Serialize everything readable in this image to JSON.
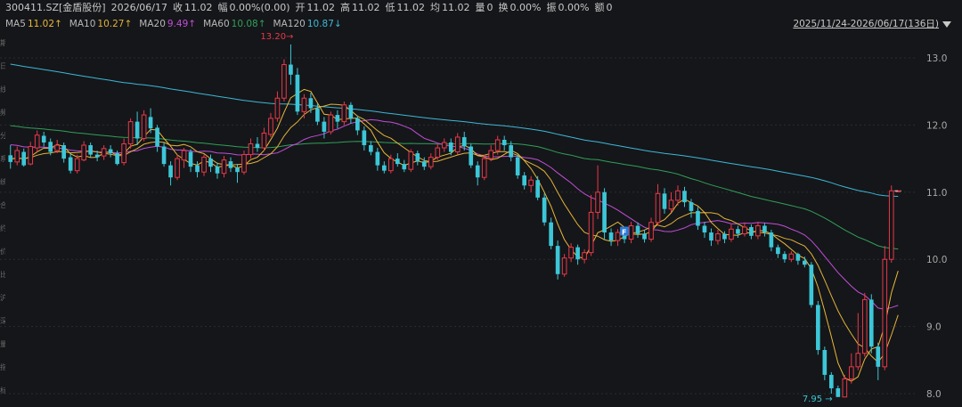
{
  "header": {
    "symbol": "300411.SZ[金盾股份]",
    "date": "2026/06/17",
    "items": [
      {
        "label": "收",
        "value": "11.02"
      },
      {
        "label": "幅",
        "value": "0.00%(0.00)"
      },
      {
        "label": "开",
        "value": "11.02"
      },
      {
        "label": "高",
        "value": "11.02"
      },
      {
        "label": "低",
        "value": "11.02"
      },
      {
        "label": "均",
        "value": "11.02"
      },
      {
        "label": "量",
        "value": "0"
      },
      {
        "label": "换",
        "value": "0.00%"
      },
      {
        "label": "振",
        "value": "0.00%"
      },
      {
        "label": "额",
        "value": "0"
      }
    ]
  },
  "ma_legend": [
    {
      "name": "MA5",
      "value": "11.02↑",
      "color": "#e8b93a"
    },
    {
      "name": "MA10",
      "value": "10.27↑",
      "color": "#e0b23a"
    },
    {
      "name": "MA20",
      "value": "9.49↑",
      "color": "#c14ed8"
    },
    {
      "name": "MA60",
      "value": "10.08↑",
      "color": "#2fa05a"
    },
    {
      "name": "MA120",
      "value": "10.87↓",
      "color": "#3cb8d8"
    }
  ],
  "range_label": "2025/11/24-2026/06/17(136日)",
  "side_glyphs": "期 日 线 频 分 系 统 合 约 价 比 沪 深 量 指 标",
  "chart_data": {
    "type": "candlestick",
    "ylim": [
      7.9,
      13.3
    ],
    "yticks": [
      "13.0",
      "12.0",
      "11.0",
      "10.0",
      "9.0",
      "8.0"
    ],
    "colors": {
      "up": "#e8394a",
      "down": "#3cc7d8",
      "ma5": "#e8b93a",
      "ma10": "#e0b23a",
      "ma20": "#c14ed8",
      "ma60": "#2fa05a",
      "ma120": "#3cb8d8"
    },
    "annotations": {
      "high": "13.20",
      "low": "7.95",
      "marker": "F"
    },
    "candles": [
      [
        11.55,
        11.45,
        11.7,
        11.35
      ],
      [
        11.45,
        11.62,
        11.68,
        11.4
      ],
      [
        11.6,
        11.4,
        11.65,
        11.38
      ],
      [
        11.42,
        11.68,
        11.75,
        11.4
      ],
      [
        11.66,
        11.85,
        11.92,
        11.6
      ],
      [
        11.84,
        11.74,
        11.9,
        11.68
      ],
      [
        11.75,
        11.6,
        11.8,
        11.55
      ],
      [
        11.62,
        11.7,
        11.78,
        11.58
      ],
      [
        11.7,
        11.5,
        11.74,
        11.44
      ],
      [
        11.52,
        11.32,
        11.58,
        11.28
      ],
      [
        11.32,
        11.5,
        11.56,
        11.28
      ],
      [
        11.48,
        11.7,
        11.76,
        11.46
      ],
      [
        11.7,
        11.56,
        11.74,
        11.52
      ],
      [
        11.56,
        11.52,
        11.62,
        11.46
      ],
      [
        11.54,
        11.65,
        11.7,
        11.48
      ],
      [
        11.64,
        11.58,
        11.7,
        11.52
      ],
      [
        11.58,
        11.42,
        11.62,
        11.4
      ],
      [
        11.44,
        11.72,
        11.8,
        11.4
      ],
      [
        11.72,
        12.05,
        12.1,
        11.65
      ],
      [
        12.05,
        11.8,
        12.2,
        11.7
      ],
      [
        11.8,
        12.15,
        12.22,
        11.76
      ],
      [
        12.12,
        11.95,
        12.25,
        11.88
      ],
      [
        11.96,
        11.68,
        12.0,
        11.6
      ],
      [
        11.68,
        11.42,
        11.74,
        11.38
      ],
      [
        11.4,
        11.22,
        11.46,
        11.1
      ],
      [
        11.22,
        11.5,
        11.56,
        11.18
      ],
      [
        11.48,
        11.62,
        11.66,
        11.36
      ],
      [
        11.6,
        11.38,
        11.64,
        11.3
      ],
      [
        11.4,
        11.3,
        11.46,
        11.22
      ],
      [
        11.3,
        11.52,
        11.56,
        11.24
      ],
      [
        11.5,
        11.38,
        11.56,
        11.3
      ],
      [
        11.38,
        11.28,
        11.44,
        11.2
      ],
      [
        11.28,
        11.48,
        11.54,
        11.22
      ],
      [
        11.46,
        11.36,
        11.52,
        11.3
      ],
      [
        11.36,
        11.3,
        11.42,
        11.14
      ],
      [
        11.3,
        11.56,
        11.62,
        11.26
      ],
      [
        11.56,
        11.72,
        11.8,
        11.5
      ],
      [
        11.72,
        11.66,
        11.82,
        11.6
      ],
      [
        11.66,
        11.88,
        11.96,
        11.62
      ],
      [
        11.86,
        12.1,
        12.18,
        11.82
      ],
      [
        12.1,
        12.4,
        12.5,
        12.05
      ],
      [
        12.4,
        12.9,
        12.98,
        12.35
      ],
      [
        12.9,
        12.75,
        13.2,
        12.6
      ],
      [
        12.75,
        12.2,
        12.85,
        12.15
      ],
      [
        12.2,
        12.4,
        12.46,
        12.1
      ],
      [
        12.4,
        12.25,
        12.48,
        12.18
      ],
      [
        12.25,
        12.05,
        12.32,
        12.0
      ],
      [
        12.05,
        11.9,
        12.12,
        11.8
      ],
      [
        11.9,
        12.15,
        12.2,
        11.86
      ],
      [
        12.15,
        12.05,
        12.22,
        11.95
      ],
      [
        12.05,
        12.3,
        12.35,
        12.0
      ],
      [
        12.3,
        12.1,
        12.34,
        12.02
      ],
      [
        12.1,
        11.92,
        12.14,
        11.85
      ],
      [
        11.92,
        11.7,
        11.98,
        11.62
      ],
      [
        11.7,
        11.6,
        11.76,
        11.55
      ],
      [
        11.6,
        11.4,
        11.66,
        11.32
      ],
      [
        11.4,
        11.32,
        11.46,
        11.28
      ],
      [
        11.32,
        11.5,
        11.56,
        11.28
      ],
      [
        11.5,
        11.42,
        11.58,
        11.38
      ],
      [
        11.42,
        11.34,
        11.48,
        11.3
      ],
      [
        11.34,
        11.6,
        11.64,
        11.3
      ],
      [
        11.58,
        11.46,
        11.62,
        11.4
      ],
      [
        11.46,
        11.38,
        11.52,
        11.33
      ],
      [
        11.38,
        11.52,
        11.58,
        11.34
      ],
      [
        11.52,
        11.66,
        11.72,
        11.48
      ],
      [
        11.66,
        11.74,
        11.8,
        11.6
      ],
      [
        11.74,
        11.6,
        11.8,
        11.55
      ],
      [
        11.6,
        11.82,
        11.88,
        11.56
      ],
      [
        11.82,
        11.68,
        11.9,
        11.62
      ],
      [
        11.68,
        11.4,
        11.72,
        11.36
      ],
      [
        11.4,
        11.22,
        11.46,
        11.1
      ],
      [
        11.22,
        11.5,
        11.56,
        11.18
      ],
      [
        11.5,
        11.62,
        11.7,
        11.46
      ],
      [
        11.62,
        11.78,
        11.84,
        11.56
      ],
      [
        11.78,
        11.7,
        11.84,
        11.62
      ],
      [
        11.7,
        11.52,
        11.76,
        11.46
      ],
      [
        11.52,
        11.25,
        11.56,
        11.2
      ],
      [
        11.25,
        11.1,
        11.3,
        11.04
      ],
      [
        11.1,
        11.18,
        11.24,
        11.0
      ],
      [
        11.18,
        10.92,
        11.24,
        10.88
      ],
      [
        10.92,
        10.55,
        10.98,
        10.5
      ],
      [
        10.55,
        10.2,
        10.62,
        10.15
      ],
      [
        10.2,
        9.78,
        10.28,
        9.7
      ],
      [
        9.78,
        10.02,
        10.08,
        9.74
      ],
      [
        10.02,
        10.18,
        10.24,
        9.96
      ],
      [
        10.18,
        10.0,
        10.22,
        9.92
      ],
      [
        10.0,
        10.1,
        10.15,
        9.94
      ],
      [
        10.1,
        10.7,
        10.96,
        10.05
      ],
      [
        10.7,
        11.0,
        11.4,
        10.6
      ],
      [
        11.0,
        10.4,
        11.06,
        10.3
      ],
      [
        10.4,
        10.28,
        10.46,
        10.2
      ],
      [
        10.28,
        10.4,
        10.45,
        10.2
      ],
      [
        10.4,
        10.3,
        10.46,
        10.24
      ],
      [
        10.3,
        10.5,
        10.56,
        10.24
      ],
      [
        10.5,
        10.38,
        10.55,
        10.32
      ],
      [
        10.38,
        10.3,
        10.44,
        10.25
      ],
      [
        10.3,
        10.55,
        10.62,
        10.26
      ],
      [
        10.55,
        10.98,
        11.12,
        10.5
      ],
      [
        10.98,
        10.75,
        11.06,
        10.68
      ],
      [
        10.75,
        10.88,
        11.0,
        10.7
      ],
      [
        10.88,
        11.02,
        11.1,
        10.8
      ],
      [
        11.02,
        10.85,
        11.08,
        10.78
      ],
      [
        10.85,
        10.72,
        10.9,
        10.62
      ],
      [
        10.72,
        10.5,
        10.78,
        10.44
      ],
      [
        10.5,
        10.4,
        10.56,
        10.32
      ],
      [
        10.4,
        10.28,
        10.46,
        10.2
      ],
      [
        10.28,
        10.38,
        10.44,
        10.22
      ],
      [
        10.38,
        10.3,
        10.42,
        10.24
      ],
      [
        10.3,
        10.45,
        10.52,
        10.26
      ],
      [
        10.45,
        10.38,
        10.5,
        10.32
      ],
      [
        10.38,
        10.48,
        10.55,
        10.34
      ],
      [
        10.48,
        10.35,
        10.52,
        10.3
      ],
      [
        10.35,
        10.5,
        10.56,
        10.3
      ],
      [
        10.5,
        10.4,
        10.54,
        10.34
      ],
      [
        10.4,
        10.18,
        10.44,
        10.12
      ],
      [
        10.18,
        10.08,
        10.22,
        10.02
      ],
      [
        10.08,
        10.0,
        10.12,
        9.95
      ],
      [
        10.0,
        10.08,
        10.12,
        9.96
      ],
      [
        10.08,
        9.98,
        10.1,
        9.92
      ],
      [
        9.98,
        9.92,
        10.04,
        9.88
      ],
      [
        9.92,
        9.32,
        9.96,
        9.28
      ],
      [
        9.32,
        8.65,
        9.38,
        8.58
      ],
      [
        8.65,
        8.28,
        8.7,
        8.2
      ],
      [
        8.28,
        8.08,
        8.32,
        8.0
      ],
      [
        8.08,
        7.95,
        8.12,
        7.95
      ],
      [
        7.95,
        8.22,
        8.28,
        7.95
      ],
      [
        8.22,
        8.4,
        8.6,
        8.15
      ],
      [
        8.4,
        8.6,
        9.2,
        8.35
      ],
      [
        8.6,
        9.4,
        9.5,
        8.55
      ],
      [
        9.4,
        8.7,
        9.48,
        8.6
      ],
      [
        8.7,
        8.4,
        8.76,
        8.2
      ],
      [
        8.4,
        10.0,
        10.2,
        8.35
      ],
      [
        10.0,
        11.02,
        11.1,
        9.95
      ],
      [
        11.02,
        11.02,
        11.02,
        11.02
      ]
    ]
  }
}
